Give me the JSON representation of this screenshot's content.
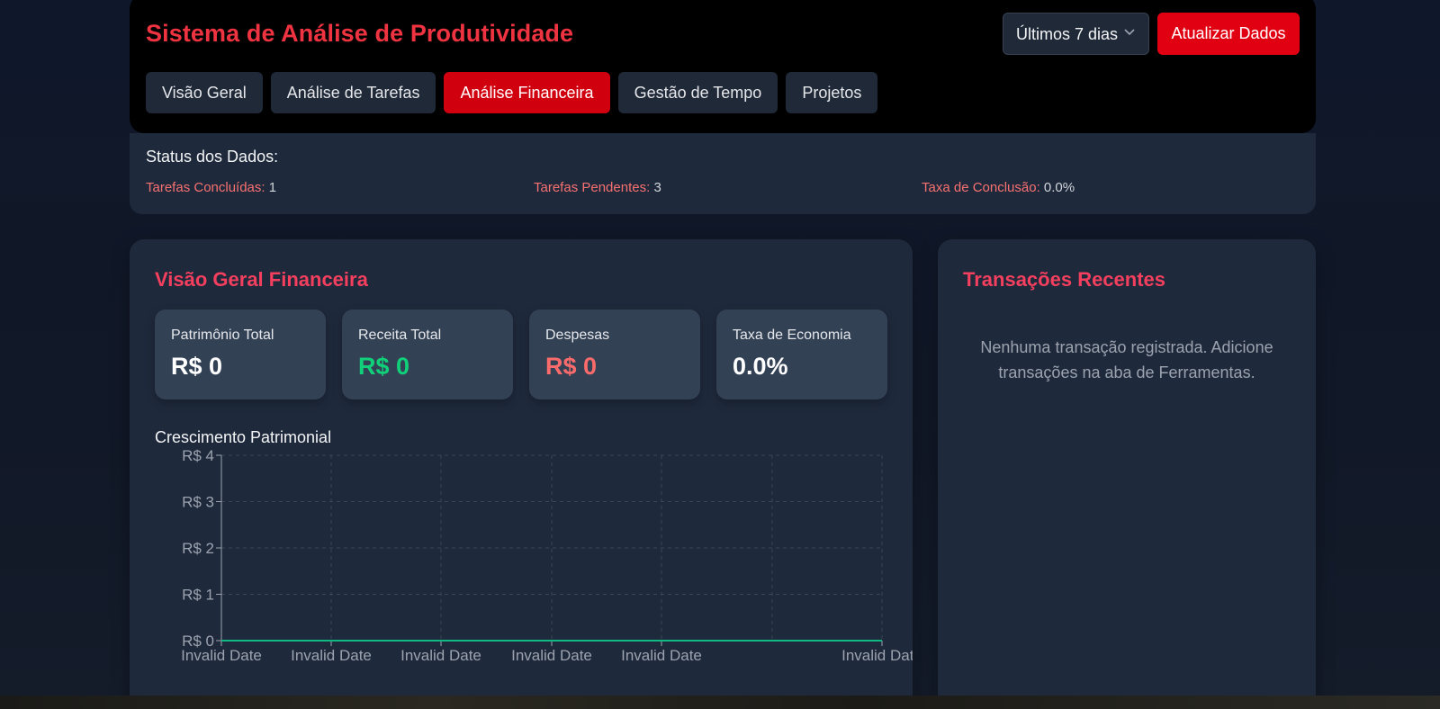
{
  "header": {
    "title": "Sistema de Análise de Produtividade",
    "range_select": "Últimos 7 dias",
    "refresh_label": "Atualizar Dados",
    "tabs": [
      {
        "label": "Visão Geral"
      },
      {
        "label": "Análise de Tarefas"
      },
      {
        "label": "Análise Financeira",
        "active": true
      },
      {
        "label": "Gestão de Tempo"
      },
      {
        "label": "Projetos"
      }
    ]
  },
  "status": {
    "title": "Status dos Dados:",
    "items": [
      {
        "label": "Tarefas Concluídas:",
        "value": "1"
      },
      {
        "label": "Tarefas Pendentes:",
        "value": "3"
      },
      {
        "label": "Taxa de Conclusão:",
        "value": "0.0%"
      }
    ]
  },
  "finance": {
    "title": "Visão Geral Financeira",
    "metrics": [
      {
        "label": "Patrimônio Total",
        "value": "R$ 0"
      },
      {
        "label": "Receita Total",
        "value": "R$ 0"
      },
      {
        "label": "Despesas",
        "value": "R$ 0"
      },
      {
        "label": "Taxa de Economia",
        "value": "0.0%"
      }
    ],
    "chart_title": "Crescimento Patrimonial"
  },
  "chart_data": {
    "type": "line",
    "categories": [
      "Invalid Date",
      "Invalid Date",
      "Invalid Date",
      "Invalid Date",
      "Invalid Date",
      "Invalid Date"
    ],
    "series": [
      {
        "values": [
          0,
          0,
          0,
          0,
          0,
          0
        ],
        "color": "#10b981"
      }
    ],
    "y_ticks": [
      "R$ 0",
      "R$ 1",
      "R$ 2",
      "R$ 3",
      "R$ 4"
    ],
    "ylim": [
      0,
      4
    ],
    "grid": true
  },
  "transactions": {
    "title": "Transações Recentes",
    "empty_message": "Nenhuma transação registrada. Adicione transações na aba de Ferramentas."
  },
  "colors": {
    "accent": "#ef3340",
    "active_tab": "#d1000f",
    "positive": "#10d07a",
    "negative": "#fb6b6b"
  },
  "icons": {
    "range_select": "chevron-down-icon"
  }
}
